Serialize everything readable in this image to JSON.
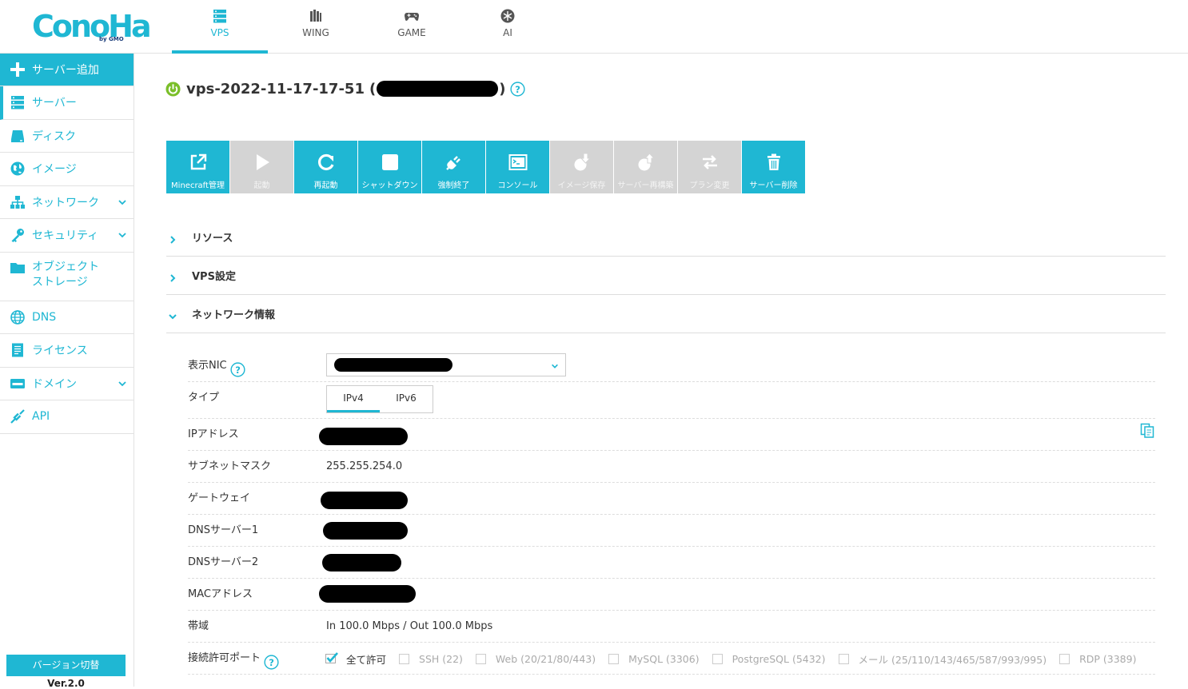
{
  "brand": {
    "logo_text": "ConoHa",
    "logo_sub": "by GMO",
    "color": "#1fb7d3"
  },
  "topnav": {
    "items": [
      {
        "label": "VPS",
        "icon": "server-stack-icon",
        "active": true
      },
      {
        "label": "WING",
        "icon": "wing-icon",
        "active": false
      },
      {
        "label": "GAME",
        "icon": "gamepad-icon",
        "active": false
      },
      {
        "label": "AI",
        "icon": "ai-icon",
        "active": false
      }
    ]
  },
  "sidebar": {
    "add_label": "サーバー追加",
    "items": [
      {
        "label": "サーバー",
        "icon": "server-icon",
        "active": true
      },
      {
        "label": "ディスク",
        "icon": "disk-icon"
      },
      {
        "label": "イメージ",
        "icon": "globe-icon"
      },
      {
        "label": "ネットワーク",
        "icon": "network-icon",
        "expandable": true
      },
      {
        "label": "セキュリティ",
        "icon": "key-icon",
        "expandable": true
      },
      {
        "label": "オブジェクト\nストレージ",
        "icon": "folder-icon"
      },
      {
        "label": "DNS",
        "icon": "dns-globe-icon"
      },
      {
        "label": "ライセンス",
        "icon": "license-icon"
      },
      {
        "label": "ドメイン",
        "icon": "domain-icon",
        "expandable": true
      },
      {
        "label": "API",
        "icon": "api-icon"
      }
    ],
    "version_button": "バージョン切替",
    "version_label": "Ver.2.0"
  },
  "server": {
    "name": "vps-2022-11-17-17-51",
    "paren_open": "(",
    "paren_close": ")",
    "status_color": "#7bbf2a"
  },
  "toolbar": [
    {
      "label": "Minecraft管理",
      "icon": "external-link-icon",
      "enabled": true
    },
    {
      "label": "起動",
      "icon": "play-icon",
      "enabled": false
    },
    {
      "label": "再起動",
      "icon": "restart-icon",
      "enabled": true
    },
    {
      "label": "シャットダウン",
      "icon": "stop-icon",
      "enabled": true
    },
    {
      "label": "強制終了",
      "icon": "plug-icon",
      "enabled": true
    },
    {
      "label": "コンソール",
      "icon": "console-icon",
      "enabled": true
    },
    {
      "label": "イメージ保存",
      "icon": "save-image-icon",
      "enabled": false
    },
    {
      "label": "サーバー再構築",
      "icon": "rebuild-icon",
      "enabled": false
    },
    {
      "label": "プラン変更",
      "icon": "swap-icon",
      "enabled": false
    },
    {
      "label": "サーバー削除",
      "icon": "trash-icon",
      "enabled": true
    }
  ],
  "sections": [
    {
      "title": "リソース",
      "expanded": false
    },
    {
      "title": "VPS設定",
      "expanded": false
    },
    {
      "title": "ネットワーク情報",
      "expanded": true
    }
  ],
  "network": {
    "nic_label": "表示NIC",
    "type_label": "タイプ",
    "type_tabs": [
      "IPv4",
      "IPv6"
    ],
    "ip_label": "IPアドレス",
    "subnet_label": "サブネットマスク",
    "subnet_value": "255.255.254.0",
    "gateway_label": "ゲートウェイ",
    "dns1_label": "DNSサーバー1",
    "dns2_label": "DNSサーバー2",
    "mac_label": "MACアドレス",
    "bandwidth_label": "帯域",
    "bandwidth_value": "In 100.0 Mbps / Out 100.0 Mbps",
    "ports_label": "接続許可ポート",
    "ports": [
      {
        "label": "全て許可",
        "checked": true
      },
      {
        "label": "SSH (22)",
        "checked": false
      },
      {
        "label": "Web (20/21/80/443)",
        "checked": false
      },
      {
        "label": "MySQL (3306)",
        "checked": false
      },
      {
        "label": "PostgreSQL (5432)",
        "checked": false
      },
      {
        "label": "メール (25/110/143/465/587/993/995)",
        "checked": false
      },
      {
        "label": "RDP (3389)",
        "checked": false
      }
    ]
  }
}
